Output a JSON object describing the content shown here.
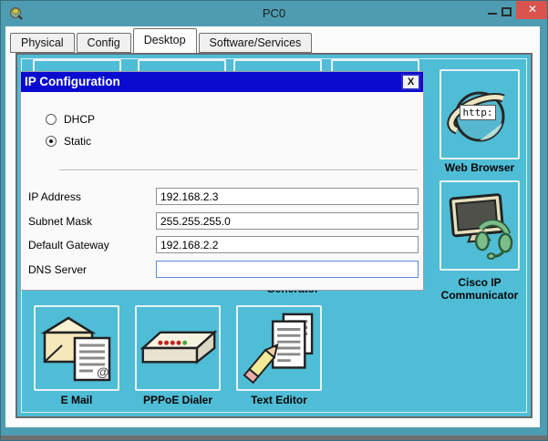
{
  "window": {
    "title": "PC0",
    "controls": {
      "minimize": "minimize",
      "maximize": "maximize",
      "close_glyph": "✕"
    }
  },
  "tabs": [
    {
      "label": "Physical",
      "active": false
    },
    {
      "label": "Config",
      "active": false
    },
    {
      "label": "Desktop",
      "active": true
    },
    {
      "label": "Software/Services",
      "active": false
    }
  ],
  "dialog": {
    "title": "IP Configuration",
    "close_label": "X",
    "radios": [
      {
        "label": "DHCP",
        "selected": false
      },
      {
        "label": "Static",
        "selected": true
      }
    ],
    "fields": [
      {
        "label": "IP Address",
        "value": "192.168.2.3",
        "focused": false
      },
      {
        "label": "Subnet Mask",
        "value": "255.255.255.0",
        "focused": false
      },
      {
        "label": "Default Gateway",
        "value": "192.168.2.2",
        "focused": false
      },
      {
        "label": "DNS Server",
        "value": "",
        "focused": true
      }
    ]
  },
  "desktop": {
    "background_partial_label": "Generator",
    "right_icons": [
      {
        "name": "web-browser",
        "label": "Web Browser",
        "badge": "http:"
      },
      {
        "name": "cisco-ip-communicator",
        "label_line1": "Cisco IP",
        "label_line2": "Communicator"
      }
    ],
    "bottom_icons": [
      {
        "name": "email",
        "label": "E Mail"
      },
      {
        "name": "pppoe-dialer",
        "label": "PPPoE Dialer"
      },
      {
        "name": "text-editor",
        "label": "Text Editor"
      }
    ]
  },
  "colors": {
    "frame_teal": "#4e9cb2",
    "desktop_teal": "#4fbdd6",
    "dialog_title_blue": "#0b0bd0",
    "close_red": "#d9544d"
  }
}
